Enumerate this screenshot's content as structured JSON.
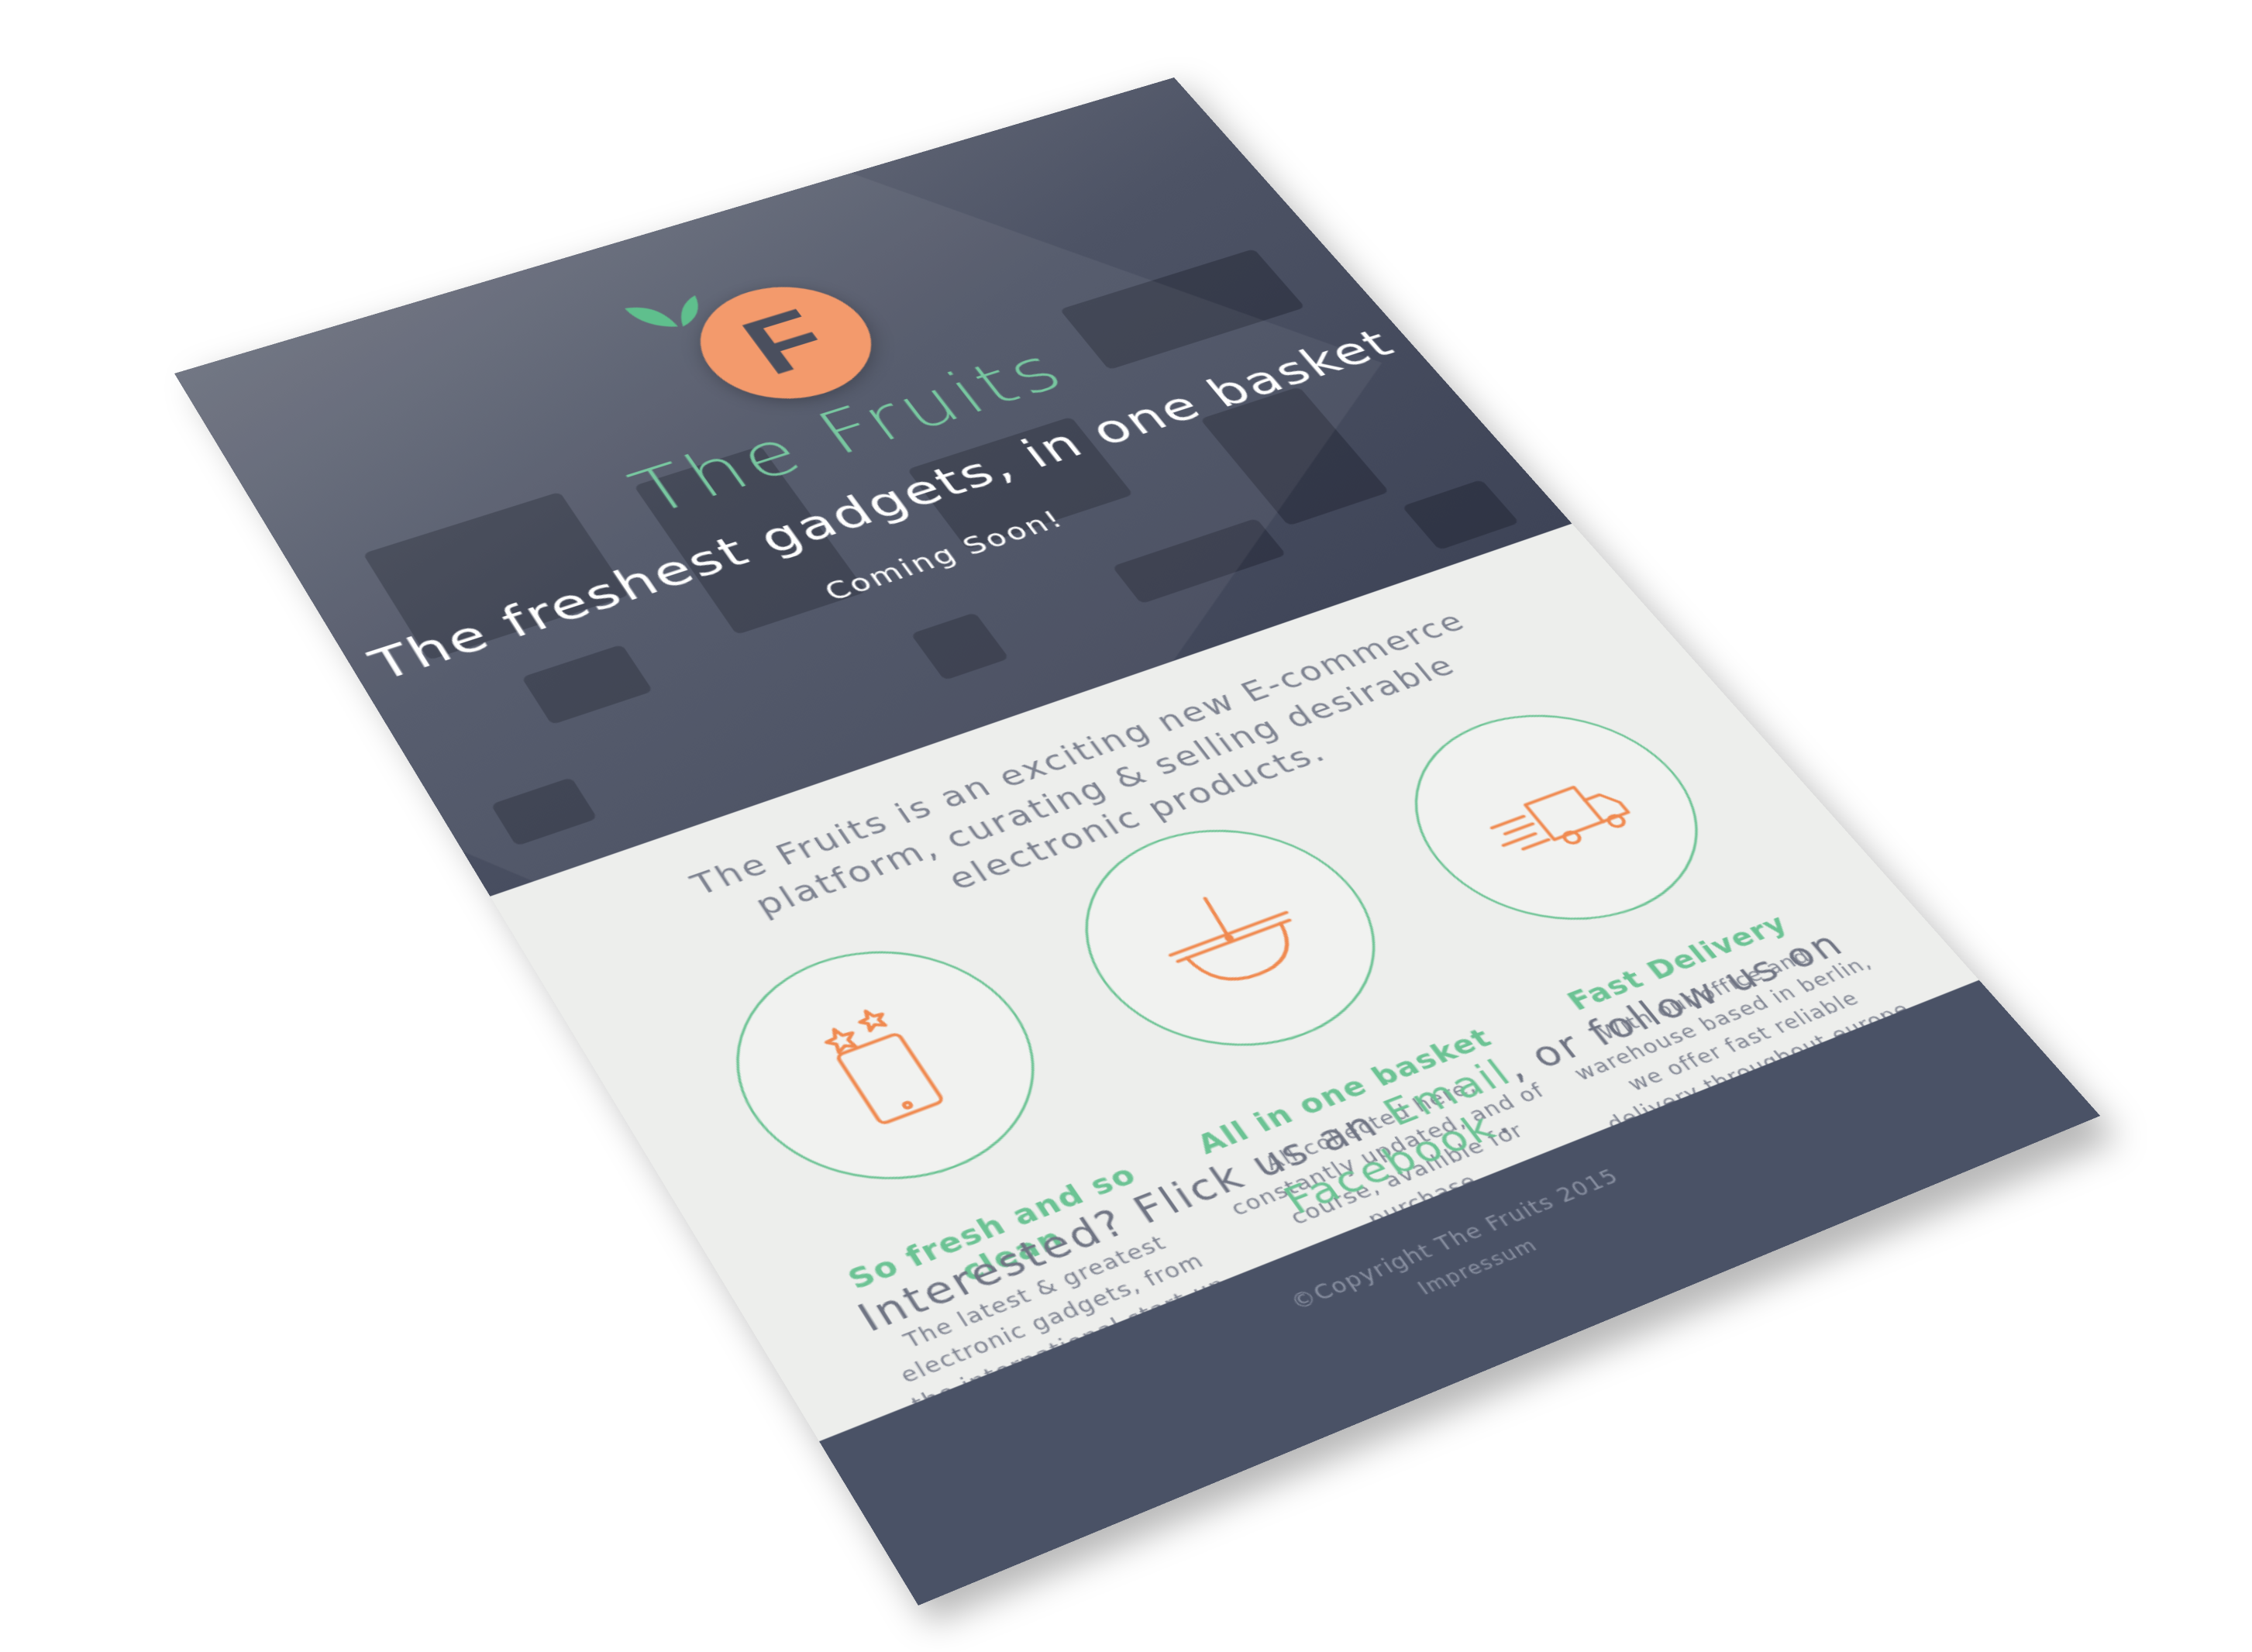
{
  "brand": {
    "logo_letter": "F",
    "name": "The Fruits",
    "tagline": "The freshest gadgets, in one basket",
    "status": "Coming Soon!"
  },
  "intro": "The Fruits is an exciting new E-commerce platform, curating & selling desirable electronic products.",
  "features": [
    {
      "icon": "tablet-sparkle-icon",
      "title": "So fresh and so clean",
      "desc": "The latest & greatest electronic gadgets, from the international start-up community."
    },
    {
      "icon": "basket-icon",
      "title": "All in one basket",
      "desc": "All collected here, constantly updated, and of course, availible for purchase."
    },
    {
      "icon": "delivery-truck-icon",
      "title": "Fast Delivery",
      "desc": "With our office and warehouse based in berlin, we offer fast reliable delivery throughout europe."
    }
  ],
  "contact": {
    "prefix": "Interested? Flick us an ",
    "email_label": "Email",
    "middle": ", or follow us on ",
    "facebook_label": "Facebook",
    "suffix": "."
  },
  "footer": {
    "copyright": "©Copyright The Fruits 2015",
    "impressum": "Impressum"
  },
  "colors": {
    "accent_green": "#6cc394",
    "accent_orange": "#f39a6c",
    "dark_slate": "#4a5266",
    "page_bg": "#edeeec"
  }
}
